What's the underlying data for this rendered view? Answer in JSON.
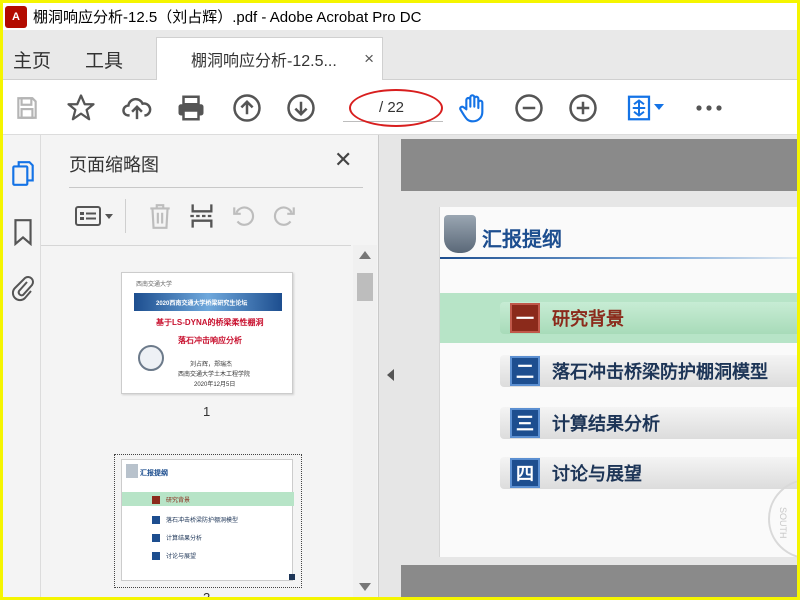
{
  "window": {
    "title": "棚洞响应分析-12.5（刘占辉）.pdf - Adobe Acrobat Pro DC",
    "app_icon": "acrobat-icon"
  },
  "tabs": {
    "home": "主页",
    "tools": "工具",
    "document": "棚洞响应分析-12.5...",
    "close": "×"
  },
  "toolbar": {
    "page_input": "",
    "page_total": "/ 22",
    "icons": [
      "save-icon",
      "star-icon",
      "cloud-upload-icon",
      "print-icon",
      "arrow-up-circle-icon",
      "arrow-down-circle-icon",
      "hand-icon",
      "zoom-out-icon",
      "zoom-in-icon",
      "fit-page-icon",
      "more-icon"
    ]
  },
  "left_rail": {
    "icons": [
      "pages-icon",
      "bookmark-icon",
      "attachment-icon"
    ]
  },
  "thumbnails_pane": {
    "title": "页面缩略图",
    "close": "✕",
    "tools": [
      "thumbnail-options-icon",
      "delete-icon",
      "insert-page-icon",
      "rotate-left-icon",
      "rotate-right-icon"
    ],
    "pages": [
      {
        "number": "1",
        "school": "西南交通大学",
        "banner": "2020西南交通大学桥梁研究生论坛",
        "line1": "基于LS-DYNA的桥梁柔性棚洞",
        "line2": "落石冲击响应分析",
        "authors": "刘占辉，郑瑞杰",
        "institute": "西南交通大学土木工程学院",
        "date": "2020年12月5日"
      },
      {
        "number": "2",
        "title": "汇报提纲",
        "items": [
          "研究背景",
          "落石冲击桥梁防护棚洞模型",
          "计算结果分析",
          "讨论与展望"
        ]
      }
    ]
  },
  "slide": {
    "heading": "汇报提纲",
    "items": [
      {
        "num": "一",
        "label": "研究背景"
      },
      {
        "num": "二",
        "label": "落石冲击桥梁防护棚洞模型"
      },
      {
        "num": "三",
        "label": "计算结果分析"
      },
      {
        "num": "四",
        "label": "讨论与展望"
      }
    ],
    "watermark": "SOUTH"
  },
  "colors": {
    "accent_blue": "#1d4e8f",
    "highlight_green": "#b7e4c7",
    "dark_red": "#8b2a1b",
    "annotation_red": "#d81e1e",
    "frame_yellow": "#f5f500"
  }
}
